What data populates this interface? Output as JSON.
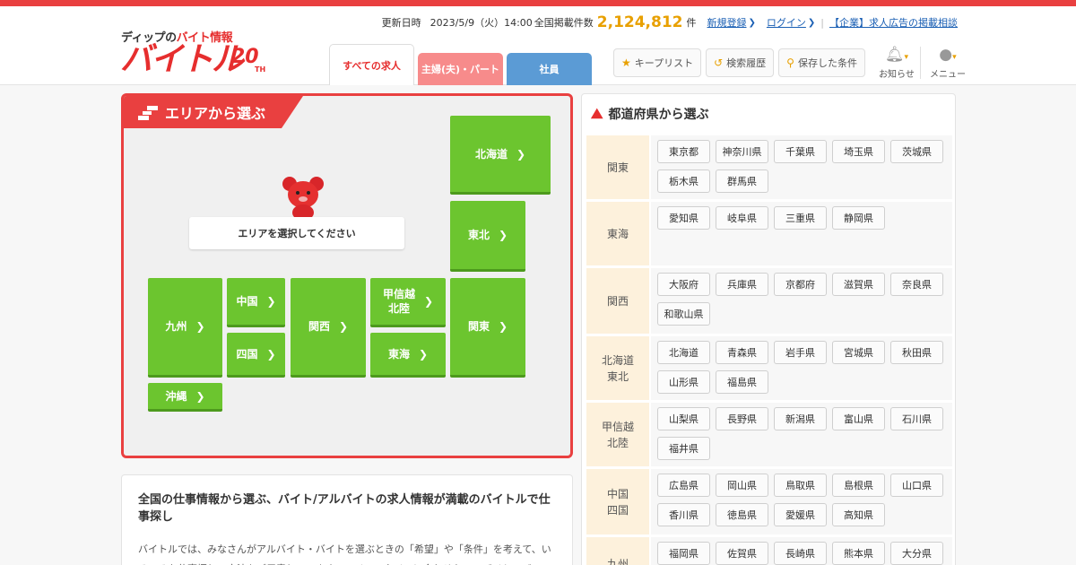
{
  "header": {
    "logo_sub_prefix": "ディップの",
    "logo_sub_red": "バイト情報",
    "logo_main": "バイトル",
    "logo_20": "20",
    "logo_th": "TH",
    "updated_label": "更新日時",
    "updated_value": "2023/5/9（火）14:00",
    "total_label": "全国掲載件数",
    "total_count": "2,124,812",
    "total_unit": "件",
    "register": "新規登録",
    "login": "ログイン",
    "corp_link": "【企業】求人広告の掲載相談",
    "tabs": {
      "all": "すべての求人",
      "part": "主婦(夫)・パート",
      "emp": "社員"
    },
    "buttons": {
      "keep": "キープリスト",
      "history": "検索履歴",
      "saved": "保存した条件"
    },
    "notice": "お知らせ",
    "menu": "メニュー"
  },
  "area": {
    "title": "エリアから選ぶ",
    "prompt": "エリアを選択してください",
    "regions": {
      "hokkaido": "北海道",
      "tohoku": "東北",
      "kanto": "関東",
      "koshinetsu_1": "甲信越",
      "koshinetsu_2": "北陸",
      "tokai": "東海",
      "kansai": "関西",
      "chugoku": "中国",
      "shikoku": "四国",
      "kyushu": "九州",
      "okinawa": "沖縄"
    }
  },
  "desc": {
    "heading": "全国の仕事情報から選ぶ、バイト/アルバイトの求人情報が満載のバイトルで仕事探し",
    "body": "バイトルでは、みなさんがアルバイト・バイトを選ぶときの「希望」や「条件」を考えて、いろいろな仕事探しの方法をご用意しています。ライフスタイルに合わせたアルバイト・バ"
  },
  "prefectures": {
    "title": "都道府県から選ぶ",
    "groups": [
      {
        "label": "関東",
        "items": [
          "東京都",
          "神奈川県",
          "千葉県",
          "埼玉県",
          "茨城県",
          "栃木県",
          "群馬県"
        ]
      },
      {
        "label": "東海",
        "items": [
          "愛知県",
          "岐阜県",
          "三重県",
          "静岡県"
        ]
      },
      {
        "label": "関西",
        "items": [
          "大阪府",
          "兵庫県",
          "京都府",
          "滋賀県",
          "奈良県",
          "和歌山県"
        ]
      },
      {
        "label": "北海道\n東北",
        "items": [
          "北海道",
          "青森県",
          "岩手県",
          "宮城県",
          "秋田県",
          "山形県",
          "福島県"
        ]
      },
      {
        "label": "甲信越\n北陸",
        "items": [
          "山梨県",
          "長野県",
          "新潟県",
          "富山県",
          "石川県",
          "福井県"
        ]
      },
      {
        "label": "中国\n四国",
        "items": [
          "広島県",
          "岡山県",
          "鳥取県",
          "島根県",
          "山口県",
          "香川県",
          "徳島県",
          "愛媛県",
          "高知県"
        ]
      },
      {
        "label": "九州",
        "items": [
          "福岡県",
          "佐賀県",
          "長崎県",
          "熊本県",
          "大分県"
        ]
      }
    ]
  }
}
